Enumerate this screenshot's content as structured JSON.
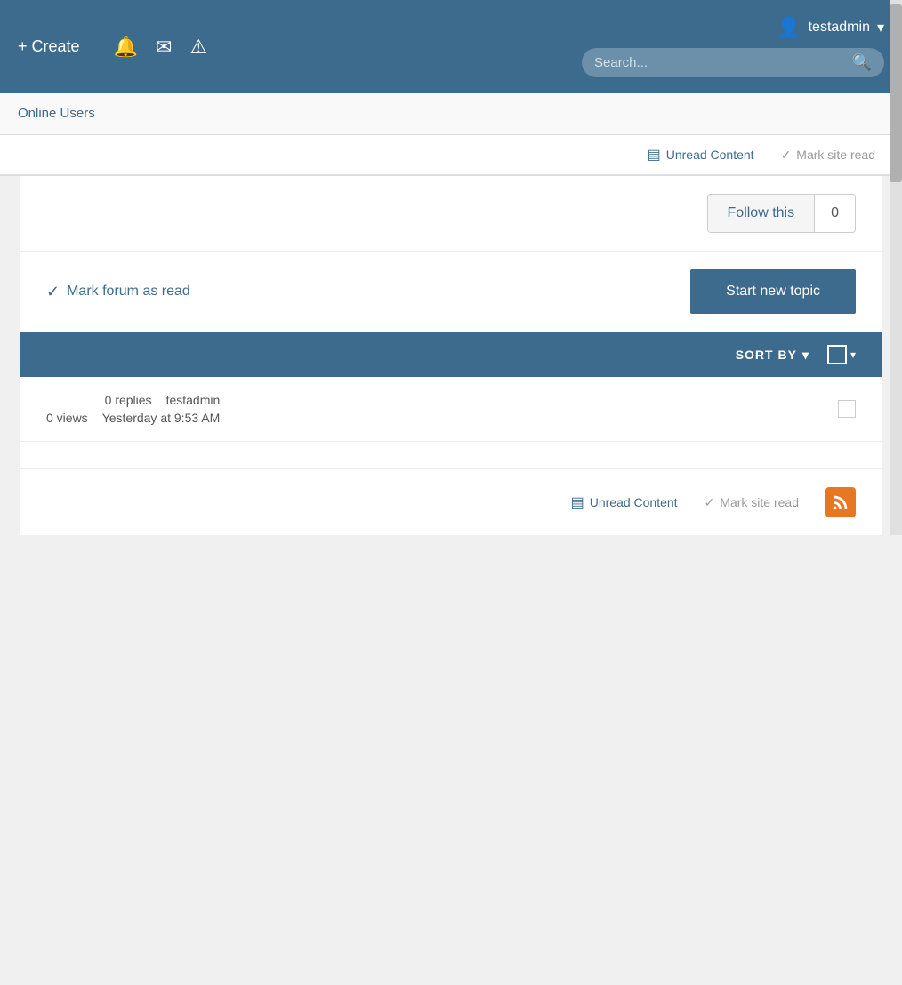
{
  "header": {
    "create_label": "+ Create",
    "search_placeholder": "Search...",
    "username": "testadmin",
    "dropdown_arrow": "▾"
  },
  "nav": {
    "online_users": "Online Users"
  },
  "toolbar": {
    "unread_content_label": "Unread Content",
    "mark_site_read_label": "Mark site read"
  },
  "follow": {
    "button_label": "Follow this",
    "count": "0"
  },
  "actions": {
    "mark_forum_read_label": "Mark forum as read",
    "start_new_topic_label": "Start new topic"
  },
  "sort_bar": {
    "sort_by_label": "SORT BY"
  },
  "topic": {
    "replies": "0 replies",
    "views": "0 views",
    "user": "testadmin",
    "time": "Yesterday at 9:53 AM"
  },
  "bottom_toolbar": {
    "unread_content_label": "Unread Content",
    "mark_site_read_label": "Mark site read"
  }
}
